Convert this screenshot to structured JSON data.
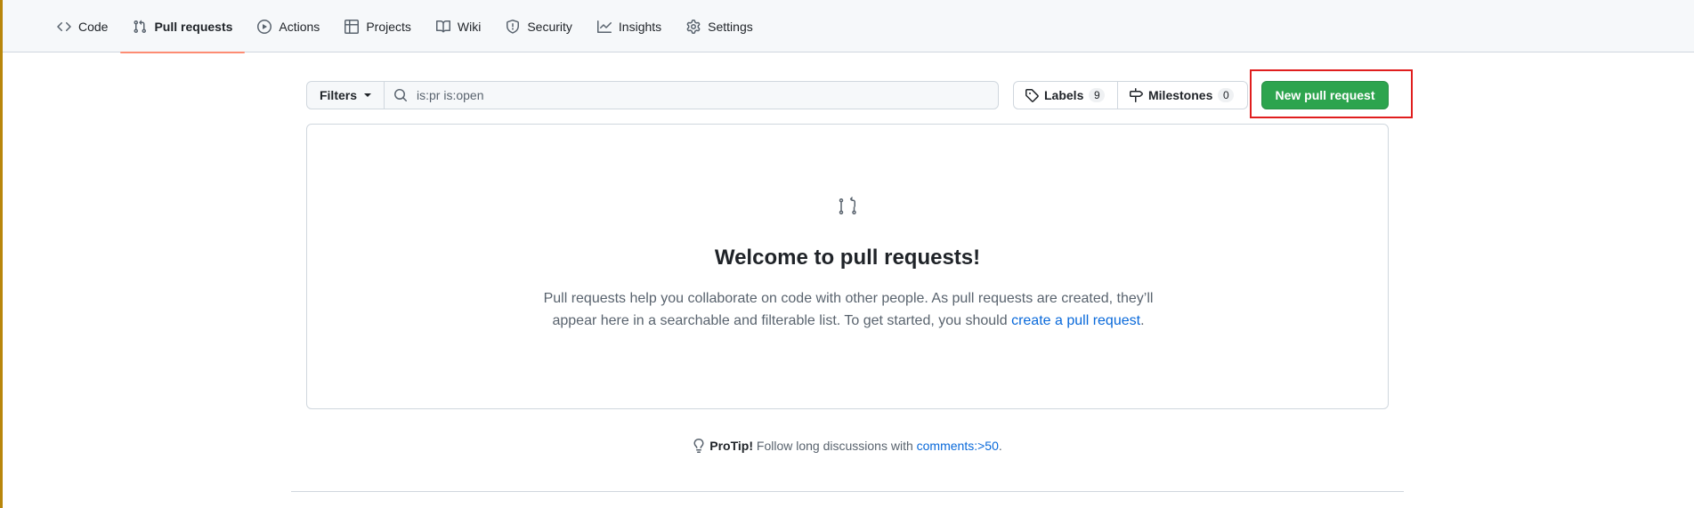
{
  "nav": {
    "tabs": [
      {
        "label": "Code",
        "icon": "code-icon"
      },
      {
        "label": "Pull requests",
        "icon": "git-pull-request-icon",
        "active": true
      },
      {
        "label": "Actions",
        "icon": "play-icon"
      },
      {
        "label": "Projects",
        "icon": "table-icon"
      },
      {
        "label": "Wiki",
        "icon": "book-icon"
      },
      {
        "label": "Security",
        "icon": "shield-icon"
      },
      {
        "label": "Insights",
        "icon": "graph-icon"
      },
      {
        "label": "Settings",
        "icon": "gear-icon"
      }
    ]
  },
  "toolbar": {
    "filters_label": "Filters",
    "search_value": "is:pr is:open",
    "labels_label": "Labels",
    "labels_count": "9",
    "milestones_label": "Milestones",
    "milestones_count": "0",
    "new_pr_label": "New pull request"
  },
  "blankslate": {
    "icon": "git-pull-request-icon",
    "title": "Welcome to pull requests!",
    "text_before_link": "Pull requests help you collaborate on code with other people. As pull requests are created, they’ll appear here in a searchable and filterable list. To get started, you should ",
    "link_text": "create a pull request",
    "text_after_link": "."
  },
  "protip": {
    "icon": "light-bulb-icon",
    "label": "ProTip!",
    "text": " Follow long discussions with ",
    "link": "comments:>50",
    "suffix": "."
  },
  "colors": {
    "accent_green": "#2da44e",
    "active_tab_underline": "#fd8c73",
    "highlight_box": "#e01e1e",
    "link_blue": "#0969da"
  }
}
